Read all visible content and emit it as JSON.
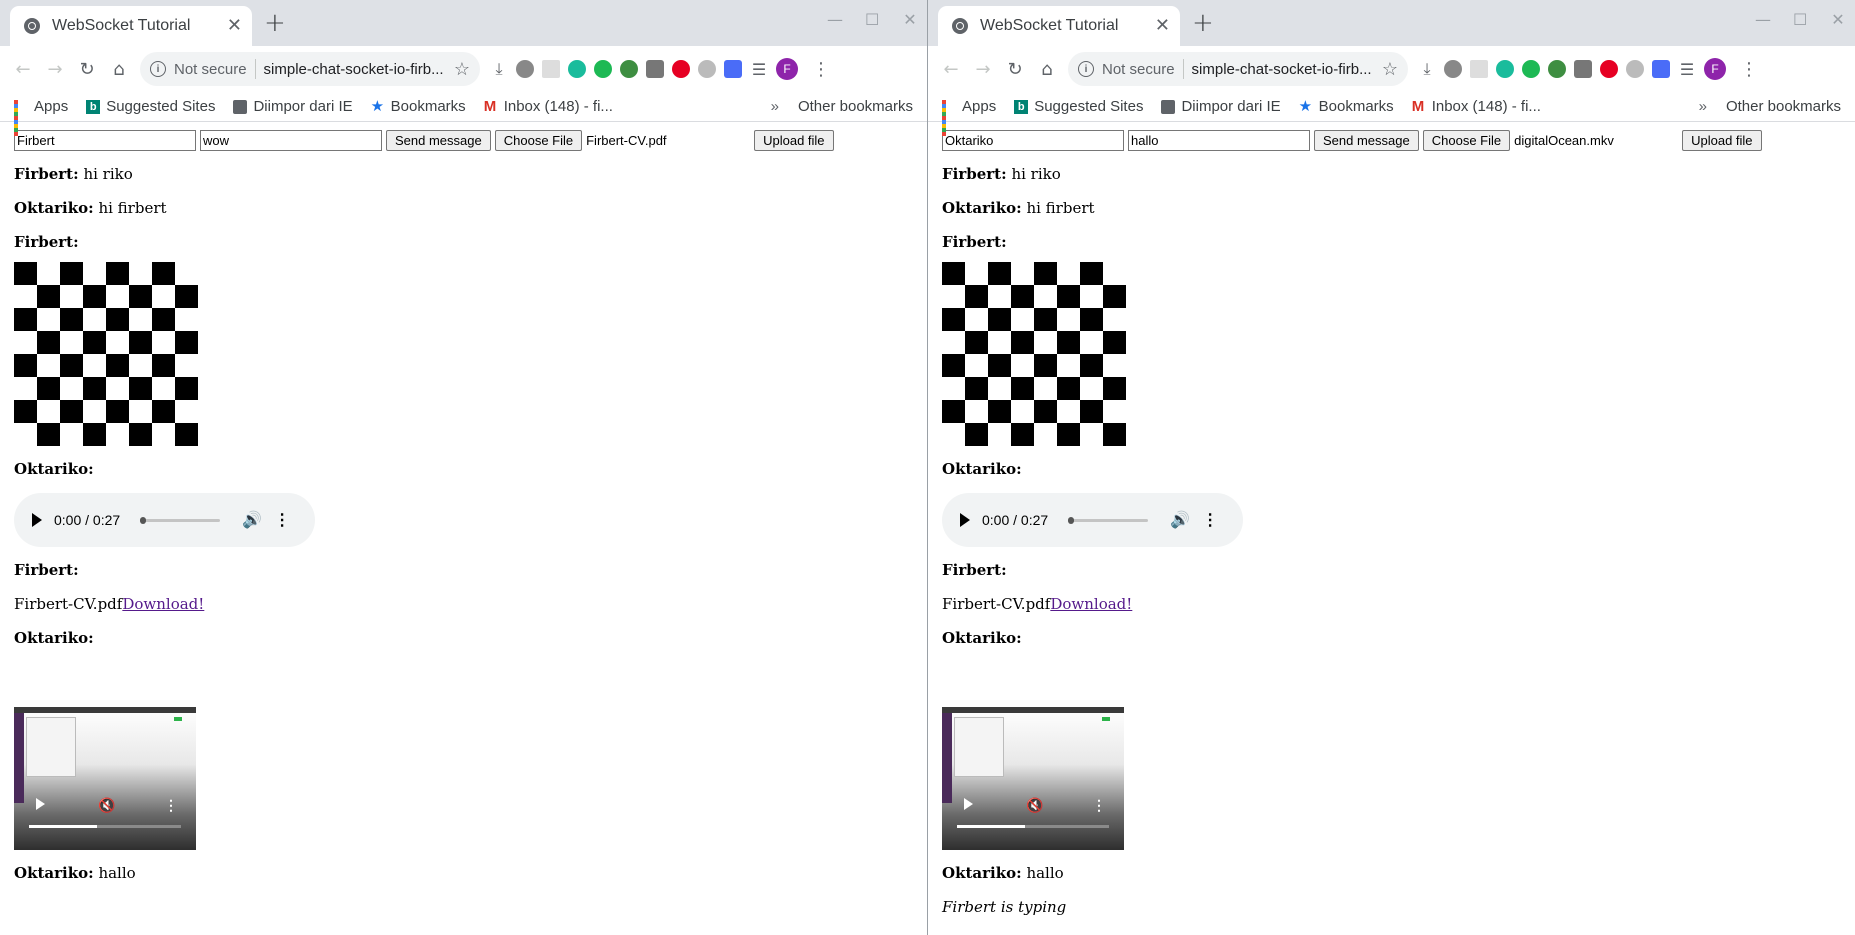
{
  "windows": [
    {
      "tab_title": "WebSocket Tutorial",
      "omnibox": {
        "security": "Not secure",
        "url": "simple-chat-socket-io-firb..."
      },
      "bookmarks": [
        "Apps",
        "Suggested Sites",
        "Diimpor dari IE",
        "Bookmarks",
        "Inbox (148) - fi...",
        "Other bookmarks"
      ],
      "bookmarks_more": "»",
      "avatar_letter": "F",
      "chat": {
        "name_value": "Firbert",
        "message_value": "wow",
        "send_label": "Send message",
        "choose_label": "Choose File",
        "file_name": "Firbert-CV.pdf",
        "upload_label": "Upload file"
      },
      "typing": ""
    },
    {
      "tab_title": "WebSocket Tutorial",
      "omnibox": {
        "security": "Not secure",
        "url": "simple-chat-socket-io-firb..."
      },
      "bookmarks": [
        "Apps",
        "Suggested Sites",
        "Diimpor dari IE",
        "Bookmarks",
        "Inbox (148) - fi...",
        "Other bookmarks"
      ],
      "bookmarks_more": "»",
      "avatar_letter": "F",
      "chat": {
        "name_value": "Oktariko",
        "message_value": "hallo",
        "send_label": "Send message",
        "choose_label": "Choose File",
        "file_name": "digitalOcean.mkv",
        "upload_label": "Upload file"
      },
      "typing": "Firbert is typing"
    }
  ],
  "messages": [
    {
      "sender": "Firbert:",
      "text": "hi riko"
    },
    {
      "sender": "Oktariko:",
      "text": "hi firbert"
    },
    {
      "sender": "Firbert:",
      "text": ""
    },
    {
      "sender": "Oktariko:",
      "text": ""
    },
    {
      "sender": "Firbert:",
      "text": ""
    },
    {
      "sender": "Oktariko:",
      "text": ""
    },
    {
      "sender": "Oktariko:",
      "text": "hallo"
    }
  ],
  "audio": {
    "time": "0:00 / 0:27"
  },
  "file_message": {
    "file_name": "Firbert-CV.pdf",
    "link_label": "Download!"
  },
  "colors": {
    "link": "#551a8b",
    "avatar": "#8e24aa"
  }
}
